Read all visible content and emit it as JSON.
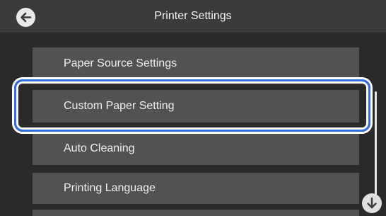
{
  "header": {
    "title": "Printer Settings",
    "back_icon": "arrow-left-icon"
  },
  "menu": {
    "items": [
      {
        "label": "Paper Source Settings"
      },
      {
        "label": "Custom Paper Setting",
        "selected": true
      },
      {
        "label": "Auto Cleaning"
      },
      {
        "label": "Printing Language"
      },
      {
        "label": ""
      }
    ]
  },
  "scroll": {
    "down_icon": "arrow-down-icon"
  },
  "colors": {
    "highlight": "#2f6fe0",
    "item_background": "#525252",
    "screen_background": "#2a2a2a"
  }
}
